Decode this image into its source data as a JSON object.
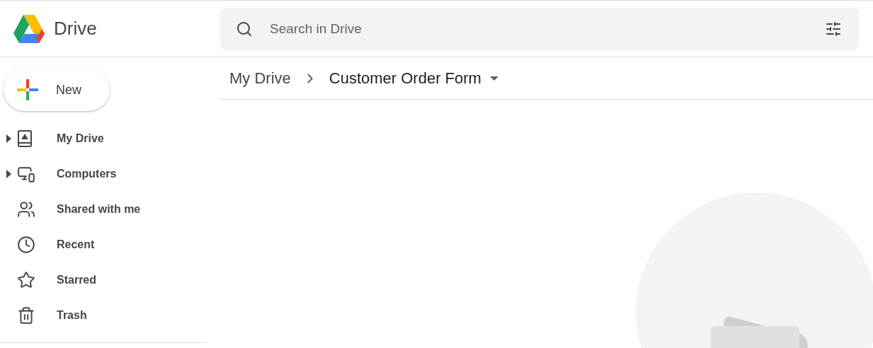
{
  "app": {
    "name": "Drive"
  },
  "search": {
    "placeholder": "Search in Drive"
  },
  "new_button": {
    "label": "New"
  },
  "nav": [
    {
      "label": "My Drive",
      "kind": "drive",
      "expandable": true
    },
    {
      "label": "Computers",
      "kind": "computers",
      "expandable": true
    },
    {
      "label": "Shared with me",
      "kind": "shared",
      "expandable": false
    },
    {
      "label": "Recent",
      "kind": "recent",
      "expandable": false
    },
    {
      "label": "Starred",
      "kind": "starred",
      "expandable": false
    },
    {
      "label": "Trash",
      "kind": "trash",
      "expandable": false
    }
  ],
  "breadcrumb": [
    {
      "label": "My Drive",
      "current": false
    },
    {
      "label": "Customer Order Form",
      "current": true
    }
  ],
  "content": {
    "kind": "empty"
  }
}
